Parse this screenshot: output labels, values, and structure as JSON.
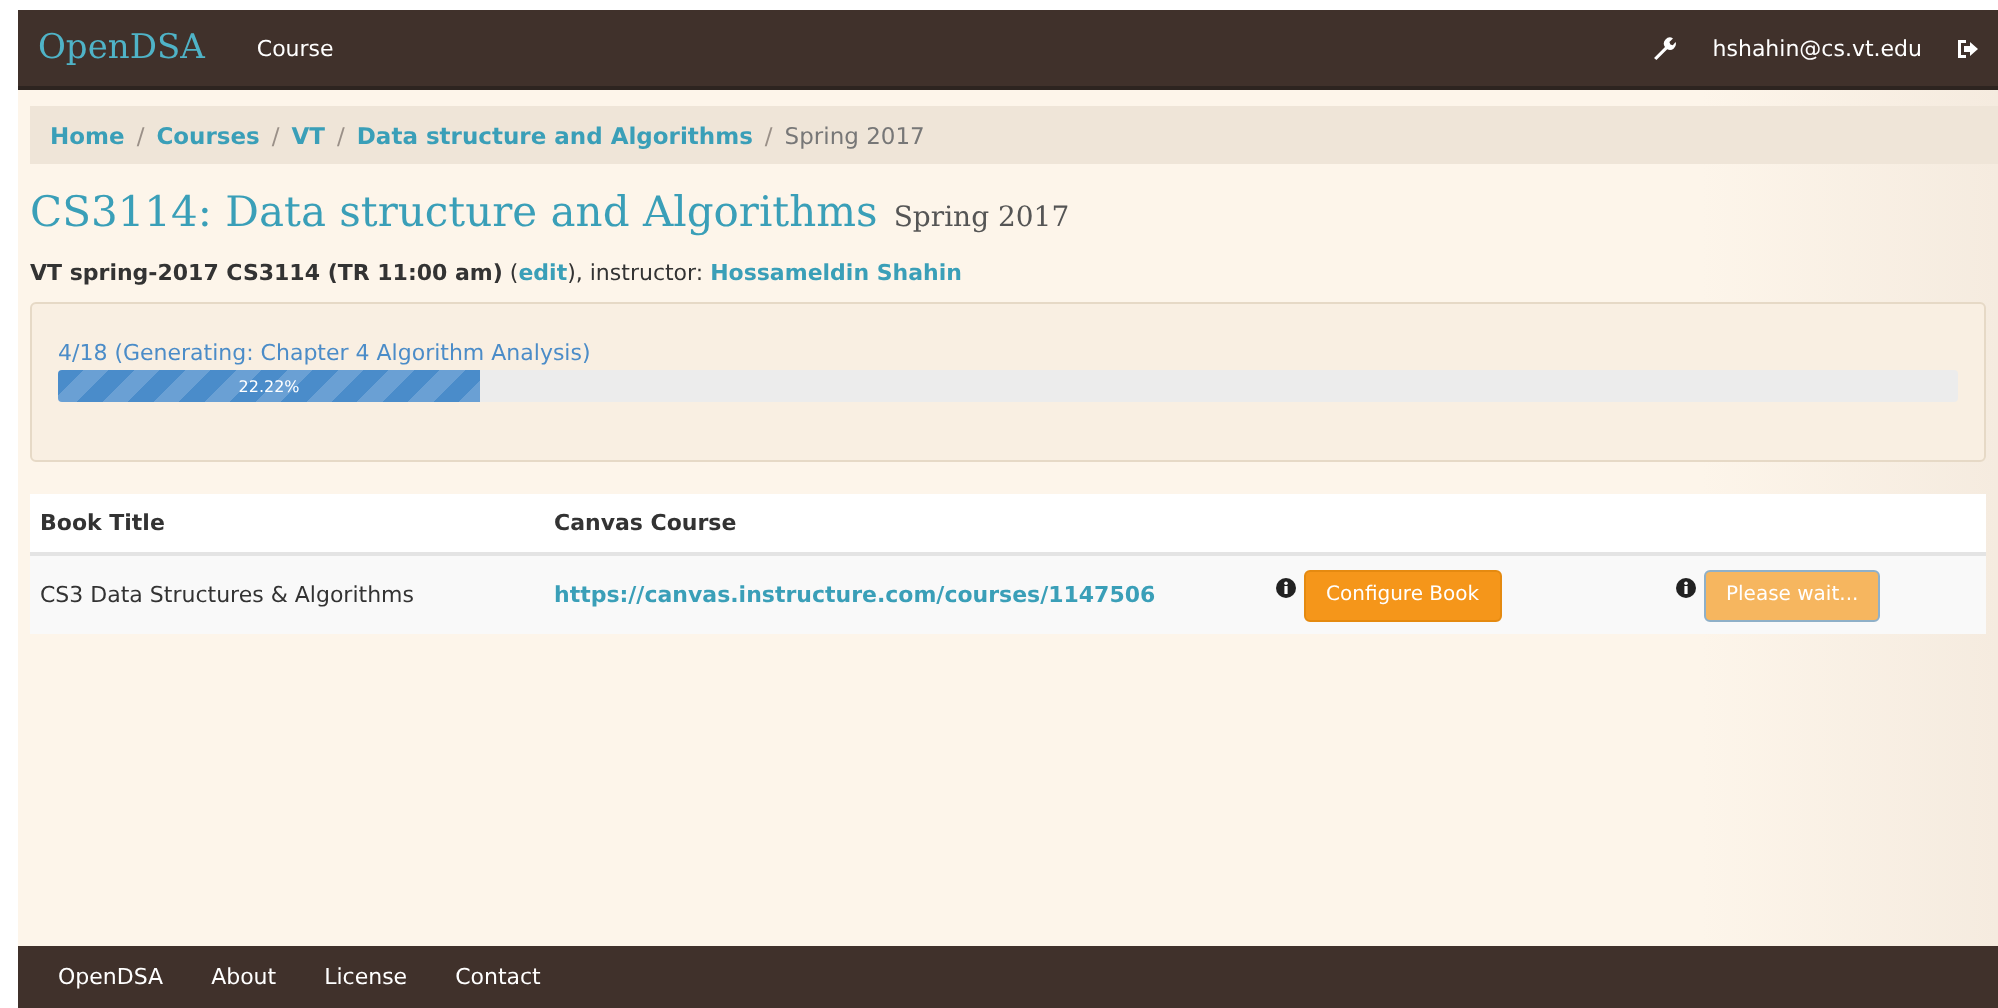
{
  "navbar": {
    "brand": "OpenDSA",
    "links": [
      "Course"
    ],
    "user": "hshahin@cs.vt.edu"
  },
  "breadcrumb_separator": "/",
  "breadcrumb": [
    {
      "label": "Home",
      "link": true
    },
    {
      "label": "Courses",
      "link": true
    },
    {
      "label": "VT",
      "link": true
    },
    {
      "label": "Data structure and Algorithms",
      "link": true
    },
    {
      "label": "Spring 2017",
      "link": false
    }
  ],
  "heading": {
    "title": "CS3114: Data structure and Algorithms",
    "term": "Spring 2017"
  },
  "offering": {
    "name": "VT spring-2017 CS3114 (TR 11:00 am)",
    "open_paren": "(",
    "edit": "edit",
    "after_edit": "), instructor:",
    "instructor": "Hossameldin Shahin"
  },
  "progress": {
    "status": "4/18 (Generating: Chapter 4 Algorithm Analysis)",
    "label": "22.22%",
    "level": 0.2222
  },
  "table": {
    "columns": [
      "Book Title",
      "Canvas Course"
    ],
    "rows": [
      {
        "title": "CS3 Data Structures & Algorithms",
        "canvas": "https://canvas.instructure.com/courses/1147506",
        "buttons": [
          {
            "label": "Configure Book",
            "disabled": false
          },
          {
            "label": "Please wait...",
            "disabled": true
          }
        ]
      }
    ]
  },
  "footer": [
    "OpenDSA",
    "About",
    "License",
    "Contact"
  ]
}
